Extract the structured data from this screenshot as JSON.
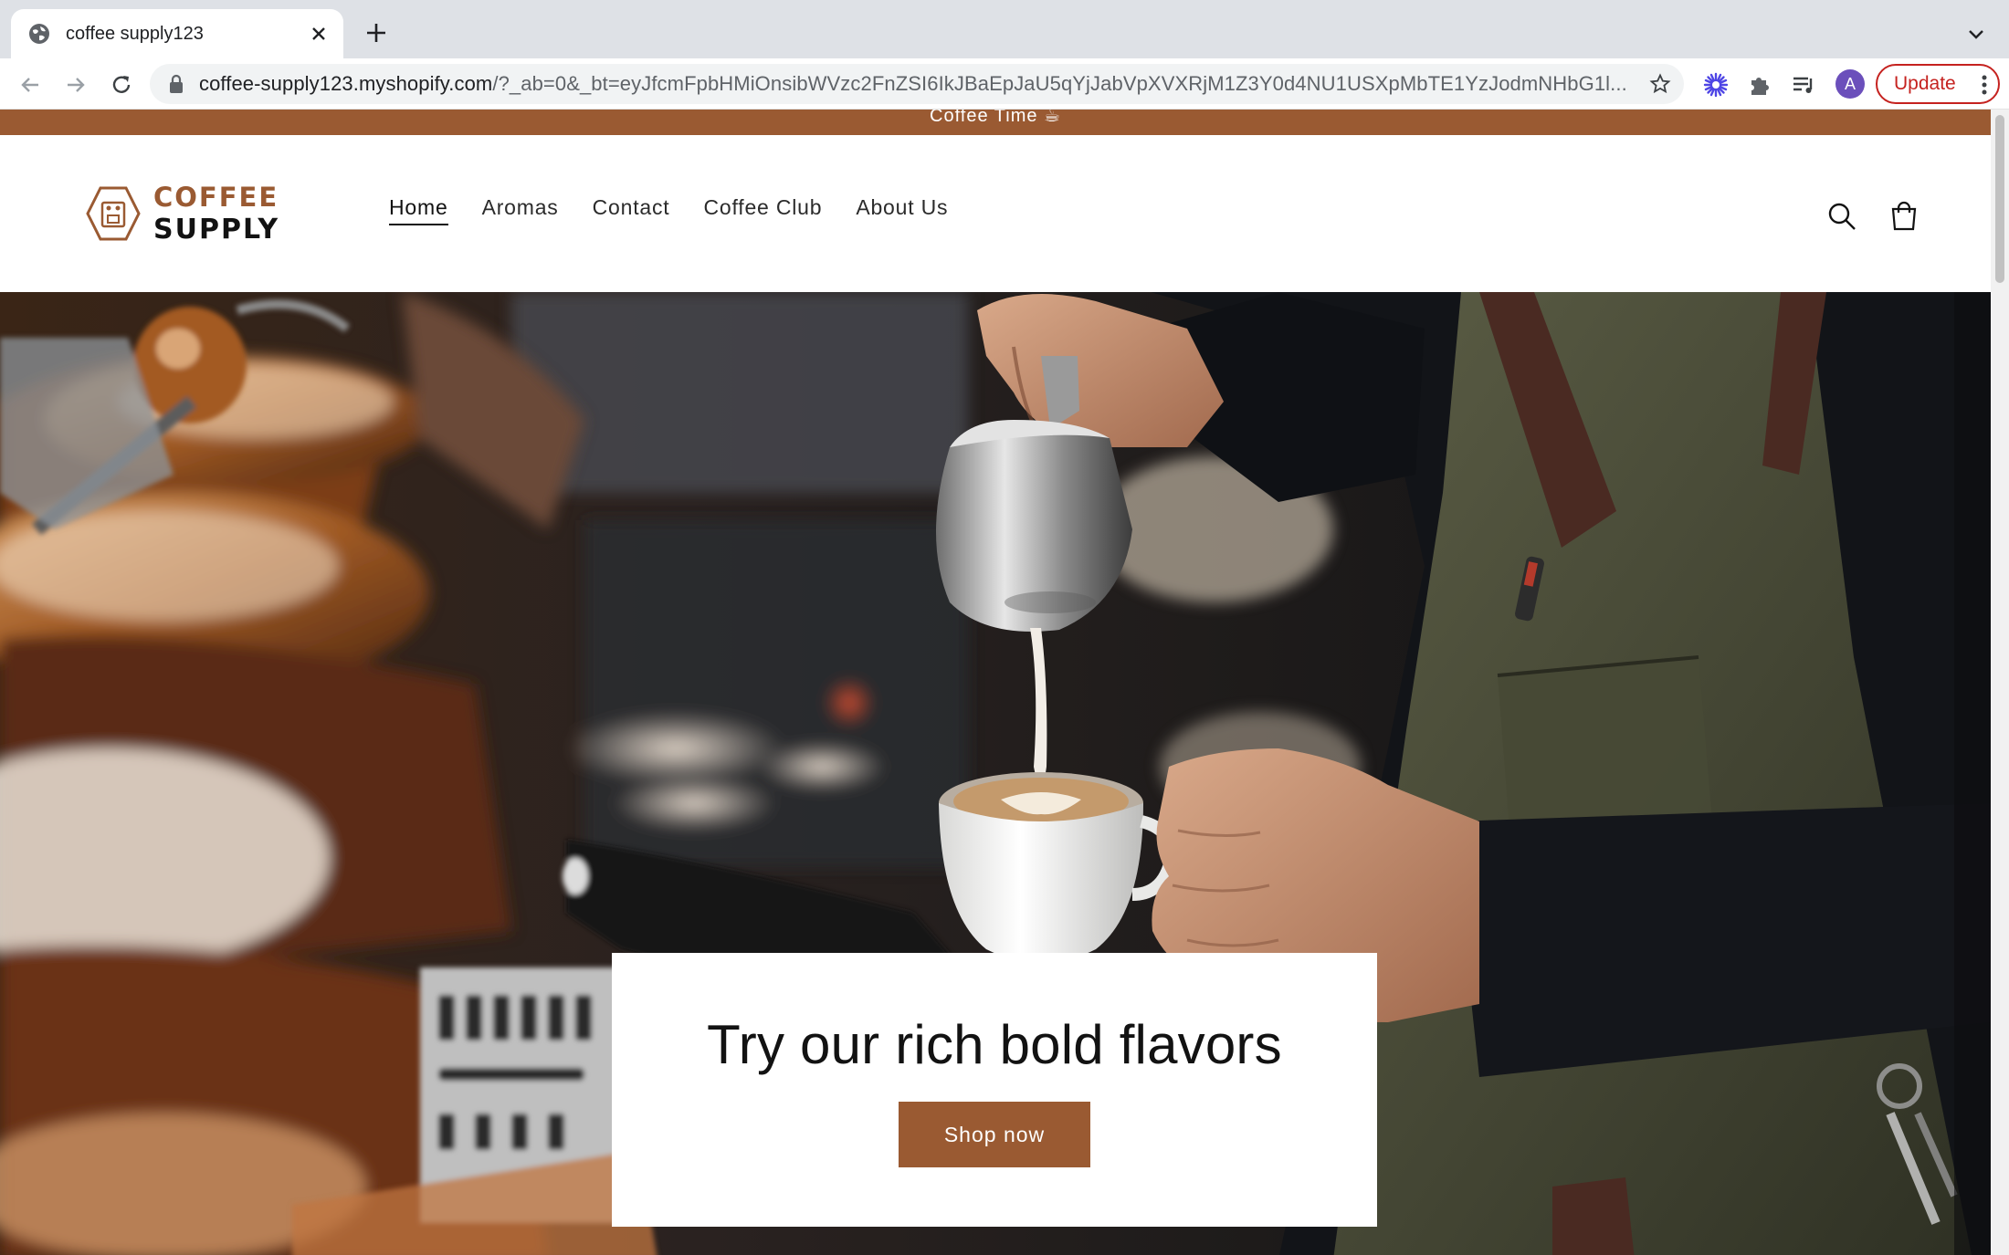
{
  "browser": {
    "tab_title": "coffee supply123",
    "url_domain": "coffee-supply123.myshopify.com",
    "url_path": "/?_ab=0&_bt=eyJfcmFpbHMiOnsibWVzc2FnZSI6IkJBaEpJaU5qYjJabVpXVXRjM1Z3Y0d4NU1USXpMbTE1YzJodmNHbG1l...",
    "update_label": "Update",
    "avatar_letter": "A",
    "icons": [
      "globe-icon",
      "close-icon",
      "plus-icon",
      "back-icon",
      "forward-icon",
      "reload-icon",
      "lock-icon",
      "star-icon",
      "extension-icon",
      "puzzle-icon",
      "media-icon",
      "kebab-icon"
    ]
  },
  "store": {
    "announcement": "Coffee Time ☕",
    "logo_line1": "COFFEE",
    "logo_line2": "SUPPLY",
    "nav": [
      {
        "label": "Home",
        "active": true
      },
      {
        "label": "Aromas",
        "active": false
      },
      {
        "label": "Contact",
        "active": false
      },
      {
        "label": "Coffee Club",
        "active": false
      },
      {
        "label": "About Us",
        "active": false
      }
    ],
    "hero_heading": "Try our rich bold flavors",
    "hero_button": "Shop now",
    "colors": {
      "accent": "#9a5a32",
      "text": "#121212"
    }
  }
}
